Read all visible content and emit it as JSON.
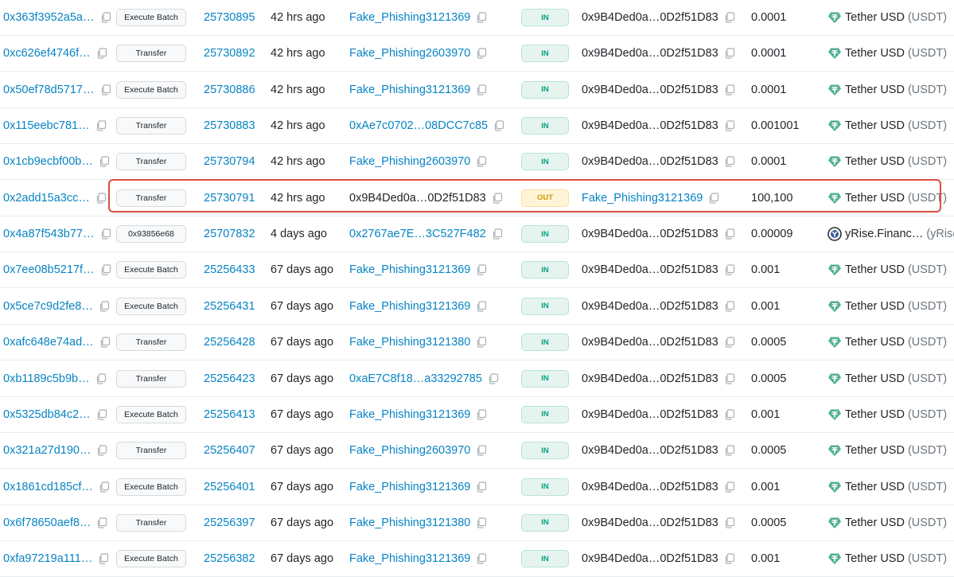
{
  "rows": [
    {
      "hash": "0x363f3952a5a…",
      "method": "Execute Batch",
      "block": "25730895",
      "age": "42 hrs ago",
      "from": "Fake_Phishing3121369",
      "direction": "IN",
      "to": "0x9B4Ded0a…0D2f51D83",
      "amount": "0.0001",
      "token_name": "Tether USD",
      "token_symbol": "(USDT)",
      "token_icon": "tether-icon"
    },
    {
      "hash": "0xc626ef4746f…",
      "method": "Transfer",
      "block": "25730892",
      "age": "42 hrs ago",
      "from": "Fake_Phishing2603970",
      "direction": "IN",
      "to": "0x9B4Ded0a…0D2f51D83",
      "amount": "0.0001",
      "token_name": "Tether USD",
      "token_symbol": "(USDT)",
      "token_icon": "tether-icon"
    },
    {
      "hash": "0x50ef78d5717…",
      "method": "Execute Batch",
      "block": "25730886",
      "age": "42 hrs ago",
      "from": "Fake_Phishing3121369",
      "direction": "IN",
      "to": "0x9B4Ded0a…0D2f51D83",
      "amount": "0.0001",
      "token_name": "Tether USD",
      "token_symbol": "(USDT)",
      "token_icon": "tether-icon"
    },
    {
      "hash": "0x115eebc781…",
      "method": "Transfer",
      "block": "25730883",
      "age": "42 hrs ago",
      "from": "0xAe7c0702…08DCC7c85",
      "direction": "IN",
      "to": "0x9B4Ded0a…0D2f51D83",
      "amount": "0.001001",
      "token_name": "Tether USD",
      "token_symbol": "(USDT)",
      "token_icon": "tether-icon"
    },
    {
      "hash": "0x1cb9ecbf00b…",
      "method": "Transfer",
      "block": "25730794",
      "age": "42 hrs ago",
      "from": "Fake_Phishing2603970",
      "direction": "IN",
      "to": "0x9B4Ded0a…0D2f51D83",
      "amount": "0.0001",
      "token_name": "Tether USD",
      "token_symbol": "(USDT)",
      "token_icon": "tether-icon"
    },
    {
      "hash": "0x2add15a3cc…",
      "method": "Transfer",
      "block": "25730791",
      "age": "42 hrs ago",
      "from": "0x9B4Ded0a…0D2f51D83",
      "direction": "OUT",
      "to": "Fake_Phishing3121369",
      "amount": "100,100",
      "token_name": "Tether USD",
      "token_symbol": "(USDT)",
      "token_icon": "tether-icon",
      "highlighted": true
    },
    {
      "hash": "0x4a87f543b77…",
      "method": "0x93856e68",
      "block": "25707832",
      "age": "4 days ago",
      "from": "0x2767ae7E…3C527F482",
      "direction": "IN",
      "to": "0x9B4Ded0a…0D2f51D83",
      "amount": "0.00009",
      "token_name": "yRise.Financ…",
      "token_symbol": "(yRise)",
      "token_icon": "yrise-icon"
    },
    {
      "hash": "0x7ee08b5217f…",
      "method": "Execute Batch",
      "block": "25256433",
      "age": "67 days ago",
      "from": "Fake_Phishing3121369",
      "direction": "IN",
      "to": "0x9B4Ded0a…0D2f51D83",
      "amount": "0.001",
      "token_name": "Tether USD",
      "token_symbol": "(USDT)",
      "token_icon": "tether-icon"
    },
    {
      "hash": "0x5ce7c9d2fe8…",
      "method": "Execute Batch",
      "block": "25256431",
      "age": "67 days ago",
      "from": "Fake_Phishing3121369",
      "direction": "IN",
      "to": "0x9B4Ded0a…0D2f51D83",
      "amount": "0.001",
      "token_name": "Tether USD",
      "token_symbol": "(USDT)",
      "token_icon": "tether-icon"
    },
    {
      "hash": "0xafc648e74ad…",
      "method": "Transfer",
      "block": "25256428",
      "age": "67 days ago",
      "from": "Fake_Phishing3121380",
      "direction": "IN",
      "to": "0x9B4Ded0a…0D2f51D83",
      "amount": "0.0005",
      "token_name": "Tether USD",
      "token_symbol": "(USDT)",
      "token_icon": "tether-icon"
    },
    {
      "hash": "0xb1189c5b9b…",
      "method": "Transfer",
      "block": "25256423",
      "age": "67 days ago",
      "from": "0xaE7C8f18…a33292785",
      "direction": "IN",
      "to": "0x9B4Ded0a…0D2f51D83",
      "amount": "0.0005",
      "token_name": "Tether USD",
      "token_symbol": "(USDT)",
      "token_icon": "tether-icon"
    },
    {
      "hash": "0x5325db84c2…",
      "method": "Execute Batch",
      "block": "25256413",
      "age": "67 days ago",
      "from": "Fake_Phishing3121369",
      "direction": "IN",
      "to": "0x9B4Ded0a…0D2f51D83",
      "amount": "0.001",
      "token_name": "Tether USD",
      "token_symbol": "(USDT)",
      "token_icon": "tether-icon"
    },
    {
      "hash": "0x321a27d190…",
      "method": "Transfer",
      "block": "25256407",
      "age": "67 days ago",
      "from": "Fake_Phishing2603970",
      "direction": "IN",
      "to": "0x9B4Ded0a…0D2f51D83",
      "amount": "0.0005",
      "token_name": "Tether USD",
      "token_symbol": "(USDT)",
      "token_icon": "tether-icon"
    },
    {
      "hash": "0x1861cd185cf…",
      "method": "Execute Batch",
      "block": "25256401",
      "age": "67 days ago",
      "from": "Fake_Phishing3121369",
      "direction": "IN",
      "to": "0x9B4Ded0a…0D2f51D83",
      "amount": "0.001",
      "token_name": "Tether USD",
      "token_symbol": "(USDT)",
      "token_icon": "tether-icon"
    },
    {
      "hash": "0x6f78650aef8…",
      "method": "Transfer",
      "block": "25256397",
      "age": "67 days ago",
      "from": "Fake_Phishing3121380",
      "direction": "IN",
      "to": "0x9B4Ded0a…0D2f51D83",
      "amount": "0.0005",
      "token_name": "Tether USD",
      "token_symbol": "(USDT)",
      "token_icon": "tether-icon"
    },
    {
      "hash": "0xfa97219a111…",
      "method": "Execute Batch",
      "block": "25256382",
      "age": "67 days ago",
      "from": "Fake_Phishing3121369",
      "direction": "IN",
      "to": "0x9B4Ded0a…0D2f51D83",
      "amount": "0.001",
      "token_name": "Tether USD",
      "token_symbol": "(USDT)",
      "token_icon": "tether-icon"
    }
  ],
  "colors": {
    "link": "#0784c3",
    "in_badge_bg": "#e6f4ef",
    "in_badge_text": "#00a186",
    "out_badge_bg": "#fff4d6",
    "out_badge_text": "#cc9a06",
    "highlight_border": "#d9503f",
    "tether_green": "#50af95"
  }
}
